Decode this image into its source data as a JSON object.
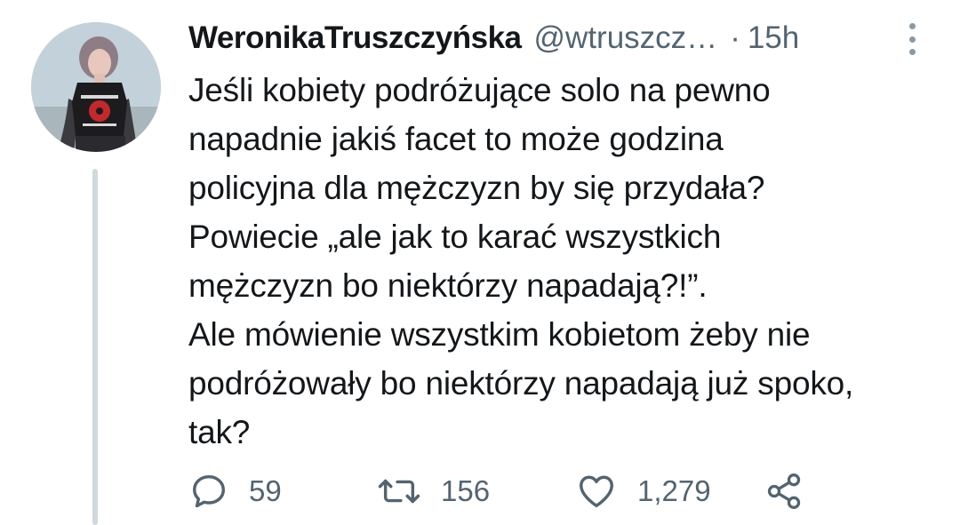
{
  "tweet": {
    "author_name": "WeronikaTruszczyńska",
    "author_handle": "@wtruszcz…",
    "separator": "·",
    "time": "15h",
    "text": "Jeśli kobiety podróżujące solo na pewno\nnapadnie jakiś facet to może godzina\npolicyjna dla mężczyzn by się przydała?\nPowiecie „ale jak to karać wszystkich\nmężczyzn bo niektórzy napadają?!”.\nAle mówienie wszystkim kobietom żeby nie\npodróżowały bo niektórzy napadają już spoko,\ntak?",
    "replies": "59",
    "retweets": "156",
    "likes": "1,279"
  },
  "icons": {
    "reply": "reply-icon",
    "retweet": "retweet-icon",
    "like": "heart-icon",
    "share": "share-icon",
    "more": "more-vertical-icon"
  },
  "colors": {
    "text": "#14171a",
    "secondary": "#536471",
    "thread_line": "#cfd9de"
  }
}
